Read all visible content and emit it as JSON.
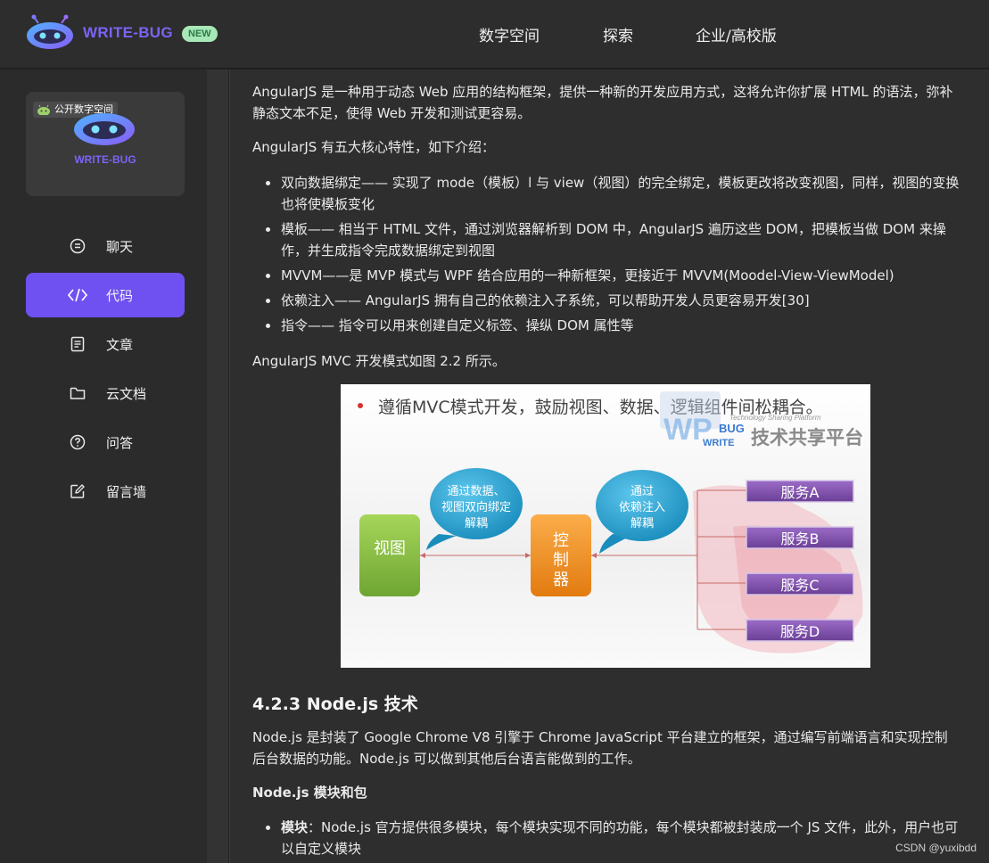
{
  "header": {
    "brand": "WRITE-BUG",
    "badge": "NEW",
    "nav": [
      "数字空间",
      "探索",
      "企业/高校版"
    ]
  },
  "sidebar": {
    "space_tag": "公开数字空间",
    "space_brand": "WRITE-BUG",
    "items": [
      {
        "label": "聊天",
        "icon": "chat-icon"
      },
      {
        "label": "代码",
        "icon": "code-icon",
        "active": true
      },
      {
        "label": "文章",
        "icon": "article-icon"
      },
      {
        "label": "云文档",
        "icon": "folder-icon"
      },
      {
        "label": "问答",
        "icon": "question-icon"
      },
      {
        "label": "留言墙",
        "icon": "edit-icon"
      }
    ]
  },
  "article": {
    "intro": "AngularJS 是一种用于动态 Web 应用的结构框架，提供一种新的开发应用方式，这将允许你扩展 HTML 的语法，弥补静态文本不足，使得 Web 开发和测试更容易。",
    "features_intro": "AngularJS 有五大核心特性，如下介绍：",
    "features": [
      "双向数据绑定—— 实现了 mode（模板）l 与 view（视图）的完全绑定，模板更改将改变视图，同样，视图的变换也将使模板变化",
      "模板—— 相当于 HTML 文件，通过浏览器解析到 DOM 中，AngularJS 遍历这些 DOM，把模板当做 DOM 来操作，并生成指令完成数据绑定到视图",
      "MVVM——是 MVP 模式与 WPF 结合应用的一种新框架，更接近于 MVVM(Moodel-View-ViewModel)",
      "依赖注入—— AngularJS 拥有自己的依赖注入子系统，可以帮助开发人员更容易开发[30]",
      "指令—— 指令可以用来创建自定义标签、操纵 DOM 属性等"
    ],
    "figure_caption": "AngularJS MVC 开发模式如图 2.2 所示。",
    "figure": {
      "headline": "遵循MVC模式开发，鼓励视图、数据、逻辑组件间松耦合。",
      "view_box": "视图",
      "controller_box": "控制器",
      "bubble_left": [
        "通过数据、",
        "视图双向绑定",
        "解耦"
      ],
      "bubble_right": [
        "通过",
        "依赖注入",
        "解耦"
      ],
      "services": [
        "服务A",
        "服务B",
        "服务C",
        "服务D"
      ],
      "logo_small": "Technology Sharing Platform",
      "logo_big": "技术共享平台",
      "logo_wp": "WP",
      "logo_bug": "BUG",
      "logo_write": "WRITE",
      "colors": {
        "view": "#8cc63f",
        "controller": "#f7941d",
        "bubble": "#29a8d6",
        "service": "#7b4ea3",
        "wash": "#f3b8c0"
      }
    },
    "section_title": "4.2.3 Node.js 技术",
    "node_intro": "Node.js 是封装了 Google Chrome V8 引擎于 Chrome JavaScript 平台建立的框架，通过编写前端语言和实现控制后台数据的功能。Node.js 可以做到其他后台语言能做到的工作。",
    "node_sub": "Node.js 模块和包",
    "node_item_label": "模块",
    "node_item_text": "：Node.js 官方提供很多模块，每个模块实现不同的功能，每个模块都被封装成一个 JS 文件，此外，用户也可以自定义模块"
  },
  "watermark": "CSDN @yuxibdd"
}
